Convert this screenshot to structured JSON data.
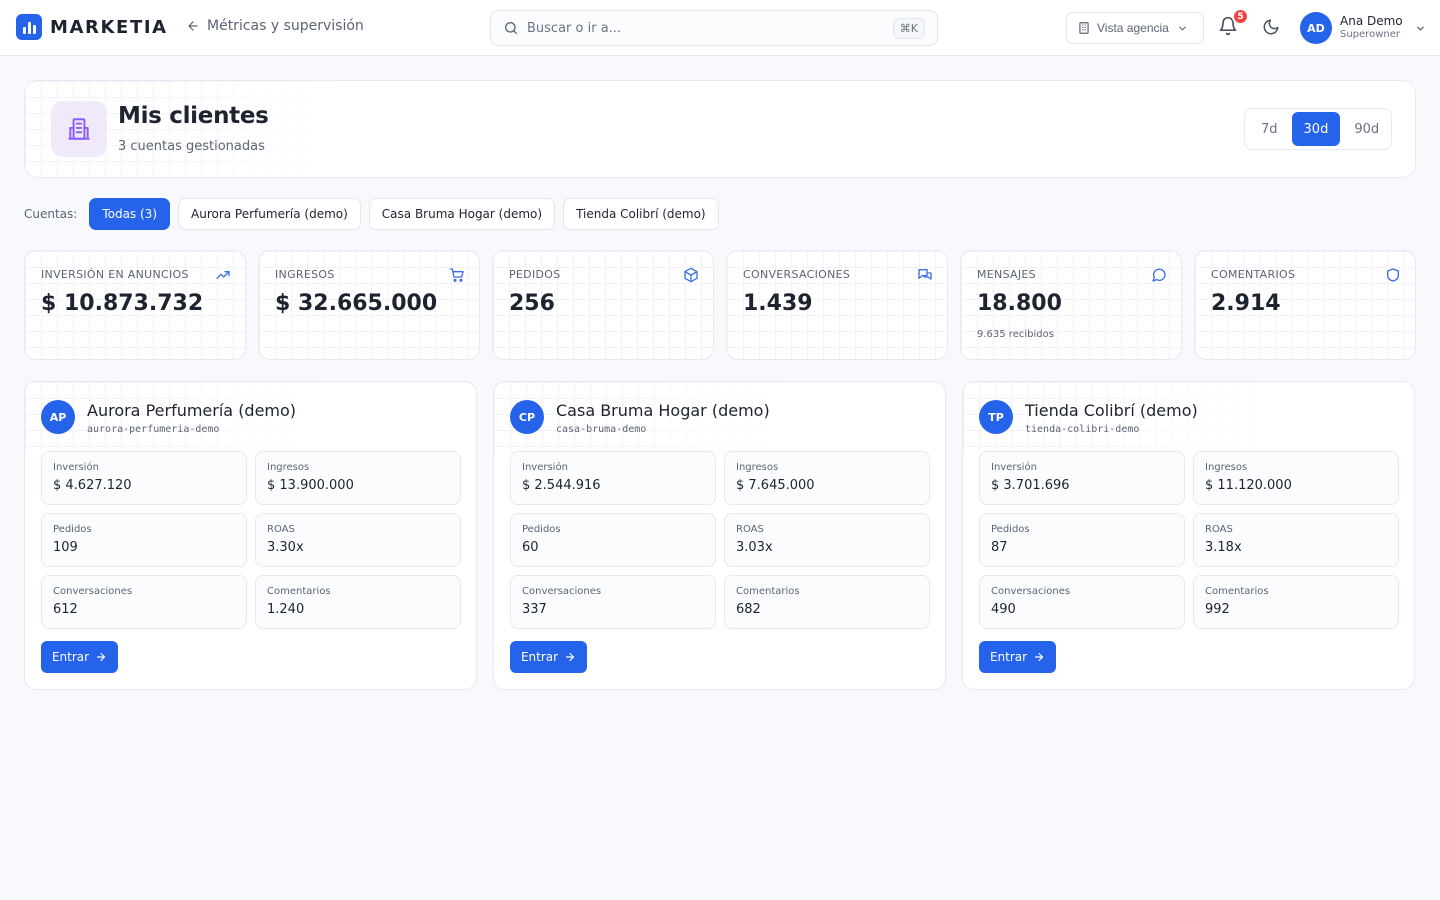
{
  "brand": {
    "name": "MARKETIA",
    "back_label": "Métricas y supervisión"
  },
  "search": {
    "placeholder": "Buscar o ir a...",
    "shortcut": "⌘K"
  },
  "topbar": {
    "agency_label": "Vista agencia",
    "notifications_count": "5",
    "user": {
      "initials": "AD",
      "name": "Ana Demo",
      "role": "Superowner"
    }
  },
  "header": {
    "title": "Mis clientes",
    "subtitle": "3 cuentas gestionadas",
    "ranges": [
      "7d",
      "30d",
      "90d"
    ],
    "active_range": "30d"
  },
  "filters": {
    "label": "Cuentas:",
    "chips": [
      "Todas (3)",
      "Aurora Perfumería (demo)",
      "Casa Bruma Hogar (demo)",
      "Tienda Colibrí (demo)"
    ]
  },
  "stats": [
    {
      "label": "Inversión en anuncios",
      "value": "$ 10.873.732",
      "icon": "trending-up-icon",
      "note": ""
    },
    {
      "label": "Ingresos",
      "value": "$ 32.665.000",
      "icon": "cart-icon",
      "note": ""
    },
    {
      "label": "Pedidos",
      "value": "256",
      "icon": "box-icon",
      "note": ""
    },
    {
      "label": "Conversaciones",
      "value": "1.439",
      "icon": "chat-icon",
      "note": ""
    },
    {
      "label": "Mensajes",
      "value": "18.800",
      "icon": "message-icon",
      "note": "9.635 recibidos"
    },
    {
      "label": "Comentarios",
      "value": "2.914",
      "icon": "shield-icon",
      "note": ""
    }
  ],
  "clients": [
    {
      "initials": "AP",
      "name": "Aurora Perfumería (demo)",
      "slug": "aurora-perfumeria-demo",
      "metrics": [
        {
          "label": "Inversión",
          "value": "$ 4.627.120"
        },
        {
          "label": "Ingresos",
          "value": "$ 13.900.000"
        },
        {
          "label": "Pedidos",
          "value": "109"
        },
        {
          "label": "ROAS",
          "value": "3.30x"
        },
        {
          "label": "Conversaciones",
          "value": "612"
        },
        {
          "label": "Comentarios",
          "value": "1.240"
        }
      ],
      "action": "Entrar"
    },
    {
      "initials": "CP",
      "name": "Casa Bruma Hogar (demo)",
      "slug": "casa-bruma-demo",
      "metrics": [
        {
          "label": "Inversión",
          "value": "$ 2.544.916"
        },
        {
          "label": "Ingresos",
          "value": "$ 7.645.000"
        },
        {
          "label": "Pedidos",
          "value": "60"
        },
        {
          "label": "ROAS",
          "value": "3.03x"
        },
        {
          "label": "Conversaciones",
          "value": "337"
        },
        {
          "label": "Comentarios",
          "value": "682"
        }
      ],
      "action": "Entrar"
    },
    {
      "initials": "TP",
      "name": "Tienda Colibrí (demo)",
      "slug": "tienda-colibri-demo",
      "metrics": [
        {
          "label": "Inversión",
          "value": "$ 3.701.696"
        },
        {
          "label": "Ingresos",
          "value": "$ 11.120.000"
        },
        {
          "label": "Pedidos",
          "value": "87"
        },
        {
          "label": "ROAS",
          "value": "3.18x"
        },
        {
          "label": "Conversaciones",
          "value": "490"
        },
        {
          "label": "Comentarios",
          "value": "992"
        }
      ],
      "action": "Entrar"
    }
  ],
  "colors": {
    "accent": "#2563eb",
    "badge": "#ef4444",
    "hero_icon_bg": "#efe9fb",
    "hero_icon": "#8b5cf6"
  }
}
